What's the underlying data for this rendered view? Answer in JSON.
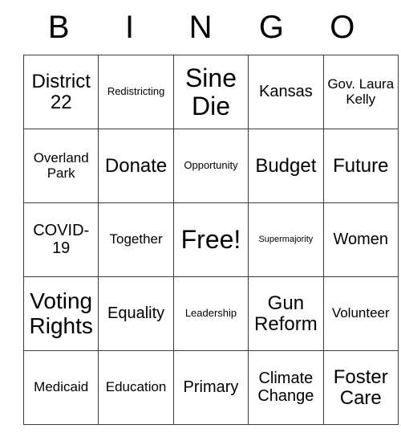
{
  "card": {
    "header": {
      "letters": [
        "B",
        "I",
        "N",
        "G",
        "O"
      ]
    },
    "rows": [
      [
        {
          "text": "District 22",
          "size": "lg"
        },
        {
          "text": "Redistricting",
          "size": "xs"
        },
        {
          "text": "Sine Die",
          "size": "xxl"
        },
        {
          "text": "Kansas",
          "size": "md"
        },
        {
          "text": "Gov. Laura Kelly",
          "size": "sm"
        }
      ],
      [
        {
          "text": "Overland Park",
          "size": "sm"
        },
        {
          "text": "Donate",
          "size": "lg"
        },
        {
          "text": "Opportunity",
          "size": "xs"
        },
        {
          "text": "Budget",
          "size": "lg"
        },
        {
          "text": "Future",
          "size": "lg"
        }
      ],
      [
        {
          "text": "COVID-19",
          "size": "md"
        },
        {
          "text": "Together",
          "size": "sm"
        },
        {
          "text": "Free!",
          "size": "xxl"
        },
        {
          "text": "Supermajority",
          "size": "xxs"
        },
        {
          "text": "Women",
          "size": "md"
        }
      ],
      [
        {
          "text": "Voting Rights",
          "size": "xl"
        },
        {
          "text": "Equality",
          "size": "md"
        },
        {
          "text": "Leadership",
          "size": "xs"
        },
        {
          "text": "Gun Reform",
          "size": "lg"
        },
        {
          "text": "Volunteer",
          "size": "sm"
        }
      ],
      [
        {
          "text": "Medicaid",
          "size": "sm"
        },
        {
          "text": "Education",
          "size": "sm"
        },
        {
          "text": "Primary",
          "size": "md"
        },
        {
          "text": "Climate Change",
          "size": "md"
        },
        {
          "text": "Foster Care",
          "size": "lg"
        }
      ]
    ]
  }
}
